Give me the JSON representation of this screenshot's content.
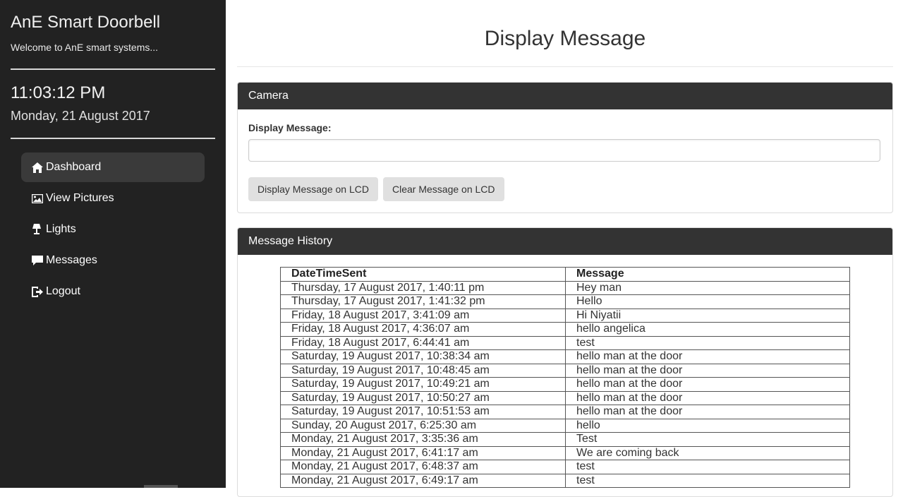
{
  "brand": {
    "title": "AnE Smart Doorbell",
    "subtitle": "Welcome to AnE smart systems..."
  },
  "clock": {
    "time": "11:03:12 PM",
    "date": "Monday, 21 August 2017"
  },
  "nav": {
    "items": [
      {
        "label": "Dashboard",
        "icon": "home-icon",
        "active": true
      },
      {
        "label": "View Pictures",
        "icon": "picture-icon",
        "active": false
      },
      {
        "label": "Lights",
        "icon": "lamp-icon",
        "active": false
      },
      {
        "label": "Messages",
        "icon": "comment-icon",
        "active": false
      },
      {
        "label": "Logout",
        "icon": "logout-icon",
        "active": false
      }
    ]
  },
  "main": {
    "title": "Display Message"
  },
  "camera_panel": {
    "heading": "Camera",
    "field_label": "Display Message:",
    "input_value": "",
    "display_button": "Display Message on LCD",
    "clear_button": "Clear Message on LCD"
  },
  "history_panel": {
    "heading": "Message History",
    "columns": [
      "DateTimeSent",
      "Message"
    ],
    "rows": [
      [
        "Thursday, 17 August 2017, 1:40:11 pm",
        "Hey man"
      ],
      [
        "Thursday, 17 August 2017, 1:41:32 pm",
        "Hello"
      ],
      [
        "Friday, 18 August 2017, 3:41:09 am",
        "Hi Niyatii"
      ],
      [
        "Friday, 18 August 2017, 4:36:07 am",
        "hello angelica"
      ],
      [
        "Friday, 18 August 2017, 6:44:41 am",
        "test"
      ],
      [
        "Saturday, 19 August 2017, 10:38:34 am",
        "hello man at the door"
      ],
      [
        "Saturday, 19 August 2017, 10:48:45 am",
        "hello man at the door"
      ],
      [
        "Saturday, 19 August 2017, 10:49:21 am",
        "hello man at the door"
      ],
      [
        "Saturday, 19 August 2017, 10:50:27 am",
        "hello man at the door"
      ],
      [
        "Saturday, 19 August 2017, 10:51:53 am",
        "hello man at the door"
      ],
      [
        "Sunday, 20 August 2017, 6:25:30 am",
        "hello"
      ],
      [
        "Monday, 21 August 2017, 3:35:36 am",
        "Test"
      ],
      [
        "Monday, 21 August 2017, 6:41:17 am",
        "We are coming back"
      ],
      [
        "Monday, 21 August 2017, 6:48:37 am",
        "test"
      ],
      [
        "Monday, 21 August 2017, 6:49:17 am",
        "test"
      ]
    ]
  },
  "colors": {
    "sidebar_bg": "#222222",
    "panel_heading_bg": "#333333",
    "active_nav_bg": "#3a3a3a",
    "button_bg": "#e0e0e0"
  }
}
